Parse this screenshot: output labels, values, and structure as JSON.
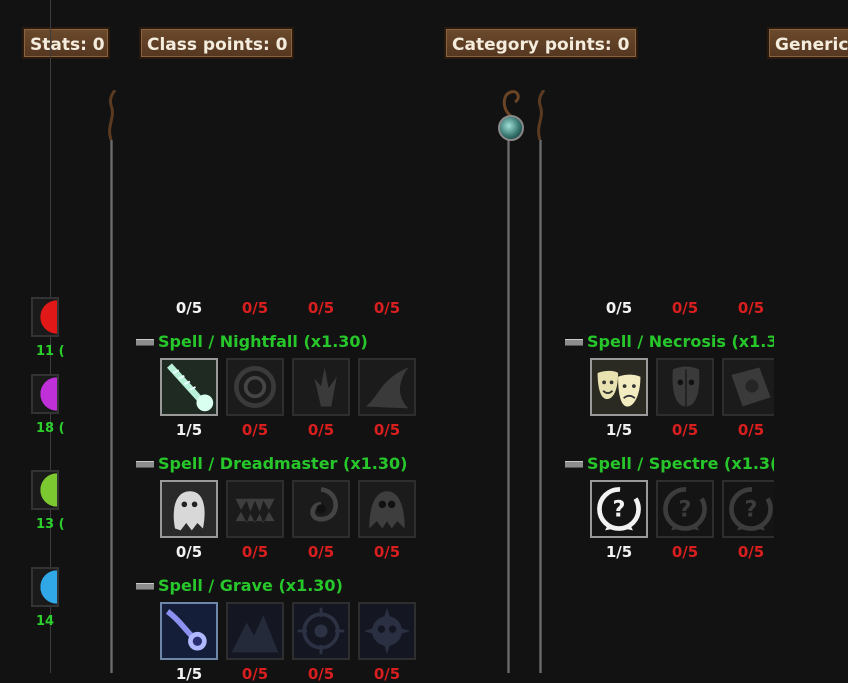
{
  "tabs": {
    "stats": "Stats: 0",
    "class_points": "Class points: 0",
    "category_points": "Category points: 0",
    "generic": "Generic"
  },
  "left_column": {
    "items": [
      {
        "num": "11 (",
        "icon": "red-emblem-icon",
        "color": "#e01818"
      },
      {
        "num": "18 (",
        "icon": "purple-burst-icon",
        "color": "#c030d8"
      },
      {
        "num": "13 (",
        "icon": "green-figure-icon",
        "color": "#7cc830"
      },
      {
        "num": "14",
        "icon": "blue-flame-icon",
        "color": "#30a8e8"
      }
    ]
  },
  "class_column": {
    "top_counts": [
      "0/5",
      "0/5",
      "0/5",
      "0/5"
    ],
    "categories": [
      {
        "title": "Spell / Nightfall (x1.30)",
        "icons": [
          "shadow-bolt-icon",
          "dark-vortex-icon",
          "shadow-burst-icon",
          "darkness-wave-icon"
        ],
        "counts": [
          "1/5",
          "0/5",
          "0/5",
          "0/5"
        ]
      },
      {
        "title": "Spell / Dreadmaster (x1.30)",
        "icons": [
          "ghost-icon",
          "fanged-maw-icon",
          "black-hole-icon",
          "skull-specter-icon"
        ],
        "counts": [
          "0/5",
          "0/5",
          "0/5",
          "0/5"
        ]
      },
      {
        "title": "Spell / Grave (x1.30)",
        "icons": [
          "spirit-comet-icon",
          "mountain-icon",
          "target-rune-icon",
          "spiked-skull-icon"
        ],
        "counts": [
          "1/5",
          "0/5",
          "0/5",
          "0/5"
        ]
      }
    ]
  },
  "category_column": {
    "top_counts": [
      "0/5",
      "0/5",
      "0/5"
    ],
    "categories": [
      {
        "title": "Spell / Necrosis (x1.3",
        "icons": [
          "theater-masks-icon",
          "dark-mask-icon",
          "cursed-tome-icon"
        ],
        "counts": [
          "1/5",
          "0/5",
          "0/5"
        ]
      },
      {
        "title": "Spell / Spectre (x1.3(",
        "icons": [
          "unknown-recycle-icon",
          "unknown-recycle-icon",
          "unknown-recycle-icon"
        ],
        "counts": [
          "1/5",
          "0/5",
          "0/5"
        ]
      }
    ]
  }
}
